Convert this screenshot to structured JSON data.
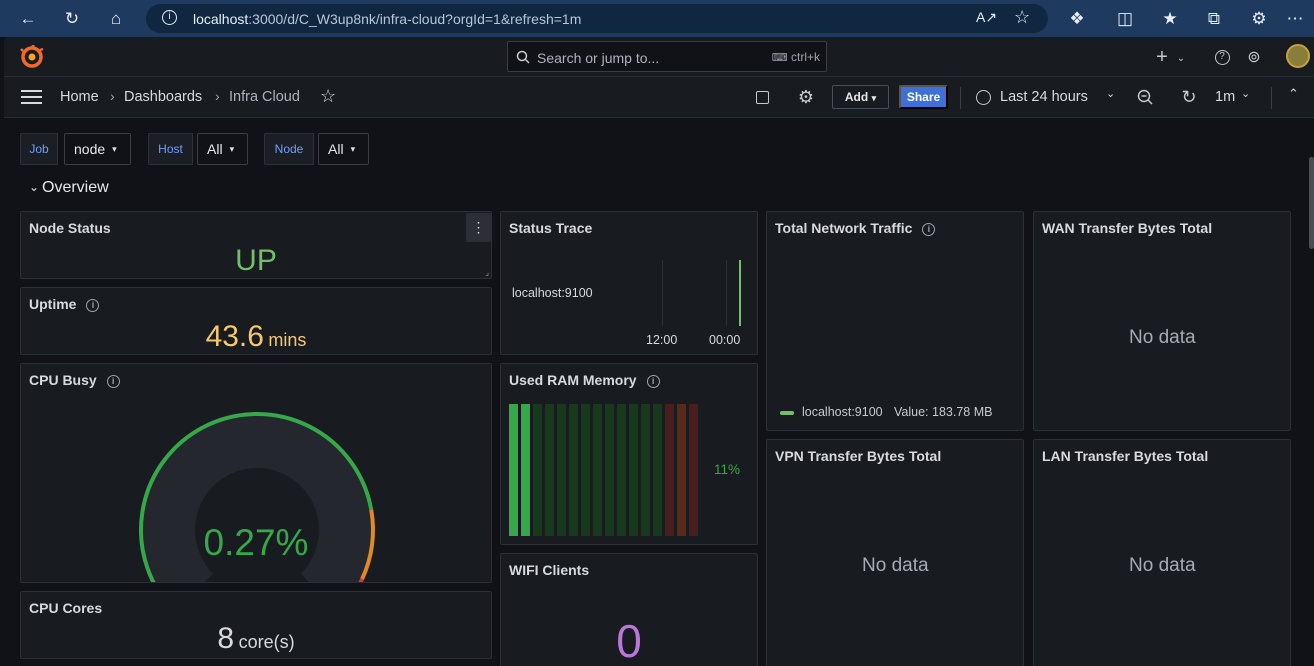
{
  "browser": {
    "url_host": "localhost",
    "url_rest": ":3000/d/C_W3up8nk/infra-cloud?orgId=1&refresh=1m"
  },
  "topnav": {
    "search_placeholder": "Search or jump to...",
    "shortcut": "ctrl+k"
  },
  "breadcrumb": [
    "Home",
    "Dashboards",
    "Infra Cloud"
  ],
  "toolbar": {
    "add_label": "Add",
    "share_label": "Share",
    "time_range": "Last 24 hours",
    "refresh_interval": "1m"
  },
  "variables": [
    {
      "label": "Job",
      "value": "node"
    },
    {
      "label": "Host",
      "value": "All"
    },
    {
      "label": "Node",
      "value": "All"
    }
  ],
  "row": {
    "title": "Overview"
  },
  "panels": {
    "node_status": {
      "title": "Node Status",
      "value": "UP",
      "color": "#73bf69"
    },
    "uptime": {
      "title": "Uptime",
      "value": "43.6",
      "unit": "mins",
      "color": "#f9c86a"
    },
    "cpu_busy": {
      "title": "CPU Busy",
      "value": "0.27%",
      "percent": 0.27,
      "color": "#37a84a"
    },
    "cpu_cores": {
      "title": "CPU Cores",
      "value": "8",
      "unit": "core(s)"
    },
    "status_trace": {
      "title": "Status Trace",
      "series": "localhost:9100",
      "ticks": [
        "12:00",
        "00:00"
      ]
    },
    "used_ram": {
      "title": "Used RAM Memory",
      "value": "11%",
      "percent": 11,
      "segments": 16,
      "lit_segments": 2
    },
    "wifi_clients": {
      "title": "WIFI Clients",
      "value": "0",
      "color": "#b877d9"
    },
    "total_network": {
      "title": "Total Network Traffic",
      "legend_series": "localhost:9100",
      "legend_value": "Value: 183.78 MB"
    },
    "wan": {
      "title": "WAN Transfer Bytes Total",
      "nodata": "No data"
    },
    "vpn": {
      "title": "VPN Transfer Bytes Total",
      "nodata": "No data"
    },
    "lan": {
      "title": "LAN Transfer Bytes Total",
      "nodata": "No data"
    }
  }
}
